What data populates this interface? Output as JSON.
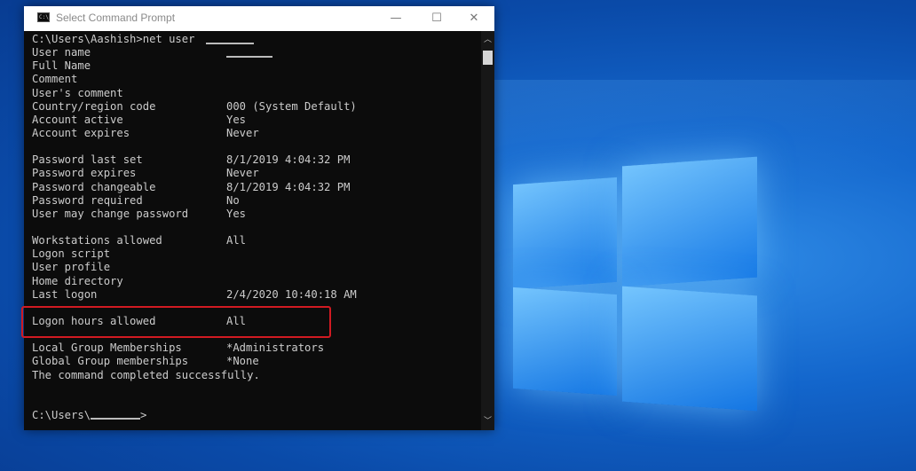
{
  "window": {
    "title": "Select Command Prompt",
    "controls": {
      "minimize": "—",
      "maximize": "☐",
      "close": "✕"
    }
  },
  "console": {
    "prompt_command": "C:\\Users\\Aashish>net user",
    "lines": [
      {
        "key": "User name",
        "value": ""
      },
      {
        "key": "Full Name",
        "value": ""
      },
      {
        "key": "Comment",
        "value": ""
      },
      {
        "key": "User's comment",
        "value": ""
      },
      {
        "key": "Country/region code",
        "value": "000 (System Default)"
      },
      {
        "key": "Account active",
        "value": "Yes"
      },
      {
        "key": "Account expires",
        "value": "Never"
      },
      {
        "key": "",
        "value": ""
      },
      {
        "key": "Password last set",
        "value": "‎8/‎1/‎2019 4:04:32 PM"
      },
      {
        "key": "Password expires",
        "value": "Never"
      },
      {
        "key": "Password changeable",
        "value": "‎8/‎1/‎2019 4:04:32 PM"
      },
      {
        "key": "Password required",
        "value": "No"
      },
      {
        "key": "User may change password",
        "value": "Yes"
      },
      {
        "key": "",
        "value": ""
      },
      {
        "key": "Workstations allowed",
        "value": "All"
      },
      {
        "key": "Logon script",
        "value": ""
      },
      {
        "key": "User profile",
        "value": ""
      },
      {
        "key": "Home directory",
        "value": ""
      },
      {
        "key": "Last logon",
        "value": "‎2/‎4/‎2020 10:40:18 AM"
      },
      {
        "key": "",
        "value": ""
      },
      {
        "key": "Logon hours allowed",
        "value": "All"
      },
      {
        "key": "",
        "value": ""
      },
      {
        "key": "Local Group Memberships",
        "value": "*Administrators"
      },
      {
        "key": "Global Group memberships",
        "value": "*None"
      },
      {
        "key": "The command completed successfully.",
        "value": ""
      },
      {
        "key": "",
        "value": ""
      },
      {
        "key": "",
        "value": ""
      }
    ],
    "final_prompt": "C:\\Users\\"
  },
  "colors": {
    "console_bg": "#0c0c0c",
    "console_text": "#cccccc",
    "highlight_border": "#d11a22",
    "desktop_blue": "#1366cc"
  },
  "icons": {
    "app": "cmd-icon",
    "scroll_up": "chevron-up-icon",
    "scroll_down": "chevron-down-icon"
  }
}
